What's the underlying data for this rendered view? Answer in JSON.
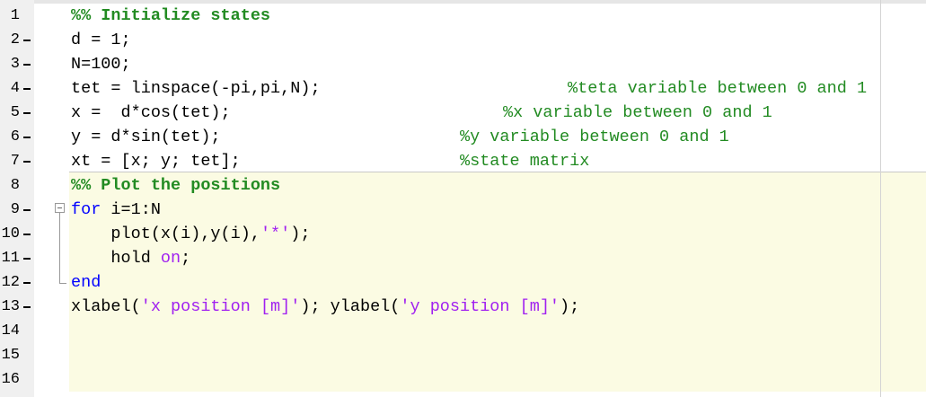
{
  "editor": {
    "lines": [
      {
        "n": "1",
        "dash": false,
        "code": "%% Initialize states",
        "type": "cell"
      },
      {
        "n": "2",
        "dash": true,
        "code": "d = 1;",
        "type": "code"
      },
      {
        "n": "3",
        "dash": true,
        "code": "N=100;",
        "type": "code"
      },
      {
        "n": "4",
        "dash": true,
        "code": "tet = linspace(-pi,pi,N);",
        "type": "code",
        "comment": "%teta variable between 0 and 1"
      },
      {
        "n": "5",
        "dash": true,
        "code": "x =  d*cos(tet);",
        "type": "code",
        "comment": "%x variable between 0 and 1"
      },
      {
        "n": "6",
        "dash": true,
        "code": "y = d*sin(tet);",
        "type": "code",
        "comment": "%y variable between 0 and 1"
      },
      {
        "n": "7",
        "dash": true,
        "code": "xt = [x; y; tet];",
        "type": "code",
        "comment": "%state matrix"
      },
      {
        "n": "8",
        "dash": false,
        "code": "%% Plot the positions",
        "type": "cell"
      },
      {
        "n": "9",
        "dash": true,
        "code": "for i=1:N",
        "type": "for"
      },
      {
        "n": "10",
        "dash": true,
        "code": "    plot(x(i),y(i),'*');",
        "type": "plot"
      },
      {
        "n": "11",
        "dash": true,
        "code": "    hold on;",
        "type": "hold"
      },
      {
        "n": "12",
        "dash": true,
        "code": "end",
        "type": "end"
      },
      {
        "n": "13",
        "dash": true,
        "code": "xlabel('x position [m]'); ylabel('y position [m]');",
        "type": "labels"
      },
      {
        "n": "14",
        "dash": false,
        "code": "",
        "type": "code"
      },
      {
        "n": "15",
        "dash": false,
        "code": "",
        "type": "code"
      },
      {
        "n": "16",
        "dash": false,
        "code": "",
        "type": "code"
      }
    ],
    "tokens": {
      "for_kw": "for",
      "for_rest": " i=1:N",
      "plot_pre": "    plot(x(i),y(i),",
      "plot_str": "'*'",
      "plot_post": ");",
      "hold_pre": "    hold ",
      "hold_kw": "on",
      "hold_post": ";",
      "end_kw": "end",
      "xl_pre": "xlabel(",
      "xl_str": "'x position [m]'",
      "yl_pre": "); ylabel(",
      "yl_str": "'y position [m]'",
      "yl_post": ");"
    },
    "colors": {
      "comment": "#228b22",
      "keyword": "#0000ff",
      "string": "#a020f0",
      "cell_highlight": "#fbfbe3",
      "gutter": "#f0f0f0"
    }
  }
}
